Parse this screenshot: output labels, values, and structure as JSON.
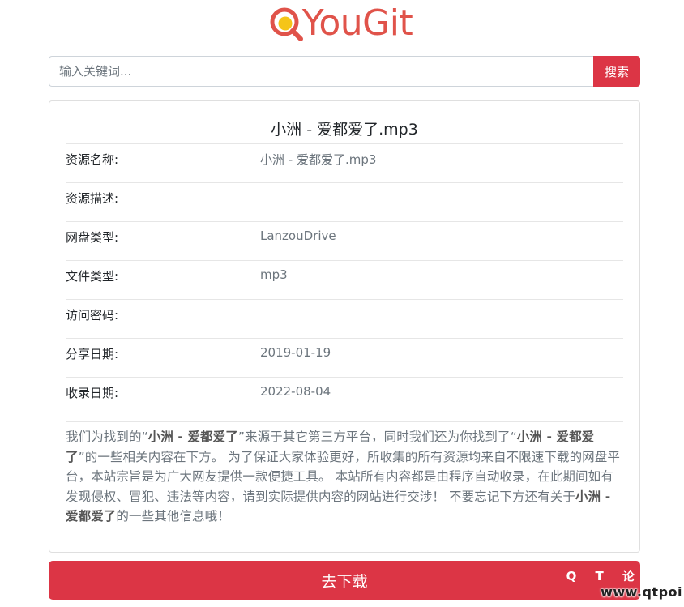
{
  "logo": {
    "text": "YouGit",
    "color": "#e0534a",
    "accent": "#f5c518"
  },
  "search": {
    "placeholder": "输入关键词...",
    "button_label": "搜索"
  },
  "resource": {
    "title": "小洲 - 爱都爱了.mp3",
    "fields": [
      {
        "label": "资源名称:",
        "value": "小洲 - 爱都爱了.mp3"
      },
      {
        "label": "资源描述:",
        "value": ""
      },
      {
        "label": "网盘类型:",
        "value": "LanzouDrive"
      },
      {
        "label": "文件类型:",
        "value": "mp3"
      },
      {
        "label": "访问密码:",
        "value": ""
      },
      {
        "label": "分享日期:",
        "value": "2019-01-19"
      },
      {
        "label": "收录日期:",
        "value": "2022-08-04"
      }
    ]
  },
  "description": {
    "p1": "我们为找到的“",
    "b1": "小洲 - 爱都爱了",
    "p2": "”来源于其它第三方平台，同时我们还为你找到了“",
    "b2": "小洲 - 爱都爱了",
    "p3": "”的一些相关内容在下方。 为了保证大家体验更好，所收集的所有资源均来自不限速下载的网盘平台，本站宗旨是为广大网友提供一款便捷工具。 本站所有内容都是由程序自动收录，在此期间如有发现侵权、冒犯、违法等内容，请到实际提供内容的网站进行交涉！ 不要忘记下方还有关于",
    "b3": "小洲 - 爱都爱了",
    "p4": "的一些其他信息哦！"
  },
  "download": {
    "label": "去下载"
  },
  "watermark": {
    "line1": "Q T 论",
    "line2": "www.qtpoi"
  },
  "colors": {
    "primary": "#dc3545",
    "muted": "#6c757d"
  }
}
